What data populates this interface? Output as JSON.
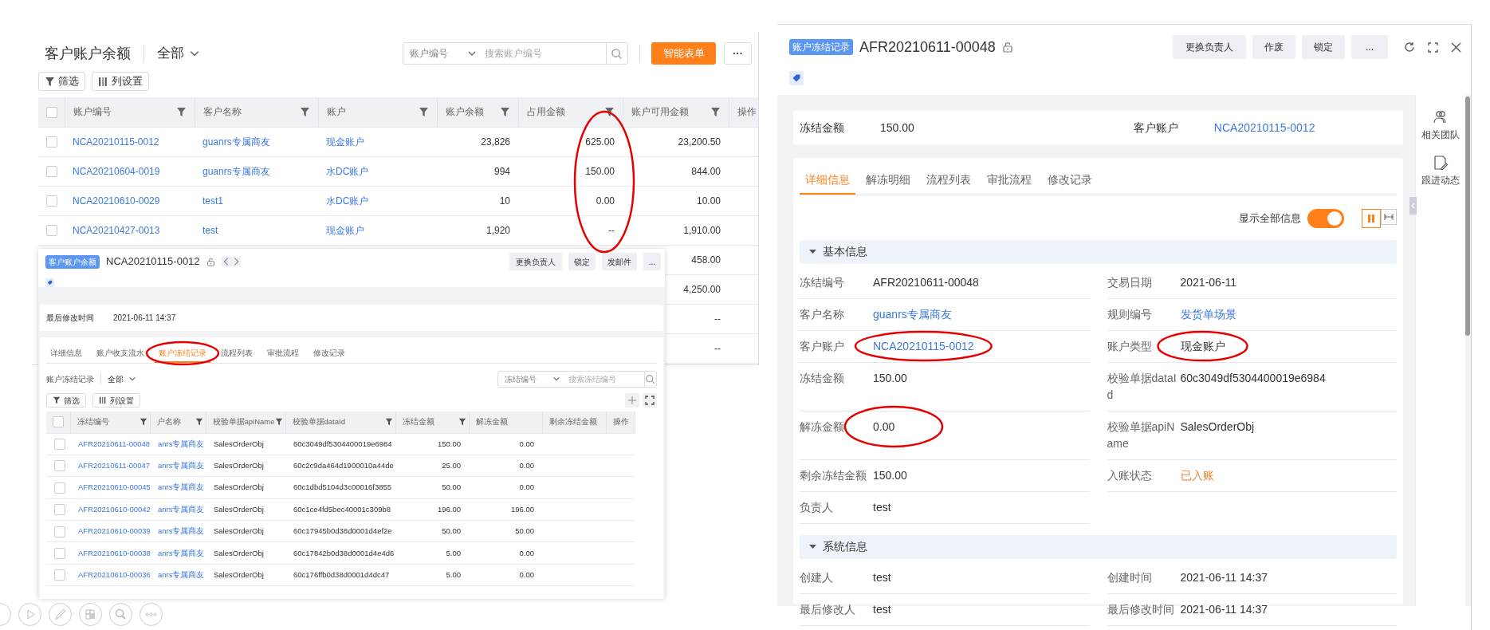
{
  "list_window": {
    "title": "客户账户余额",
    "scope": "全部",
    "search": {
      "field": "账户编号",
      "placeholder": "搜索账户编号"
    },
    "primary_button": "智能表单",
    "more_button": "···",
    "toolbar": [
      "筛选",
      "列设置"
    ],
    "table": {
      "all_checked": false,
      "columns": [
        "账户编号",
        "客户名称",
        "账户",
        "账户余额",
        "占用金额",
        "账户可用金额",
        "操作"
      ],
      "rows": [
        {
          "checked": false,
          "account_no": "NCA20210115-0012",
          "customer": "guanrs专属商友",
          "account": "现金账户",
          "balance": "23,826",
          "occupied": "625.00",
          "available": "23,200.50"
        },
        {
          "checked": false,
          "account_no": "NCA20210604-0019",
          "customer": "guanrs专属商友",
          "account": "水DC账户",
          "balance": "994",
          "occupied": "150.00",
          "available": "844.00"
        },
        {
          "checked": false,
          "account_no": "NCA20210610-0029",
          "customer": "test1",
          "account": "水DC账户",
          "balance": "10",
          "occupied": "0.00",
          "available": "10.00"
        },
        {
          "checked": false,
          "account_no": "NCA20210427-0013",
          "customer": "test",
          "account": "现金账户",
          "balance": "1,920",
          "occupied": "--",
          "available": "1,910.00"
        },
        {
          "available": "458.00"
        },
        {
          "available": "4,250.00"
        },
        {
          "available": "--"
        },
        {
          "available": "--"
        }
      ]
    }
  },
  "list_detail": {
    "badge": "客户账户余额",
    "title": "NCA20210115-0012",
    "buttons": [
      "更换负责人",
      "锁定",
      "发邮件",
      "..."
    ],
    "summary": [
      {
        "label": "最后修改时间",
        "value": "2021-06-11 14:37"
      }
    ],
    "tabs": [
      {
        "label": "详细信息",
        "selected": false
      },
      {
        "label": "账户收支流水",
        "selected": false
      },
      {
        "label": "账户冻结记录",
        "selected": true
      },
      {
        "label": "流程列表",
        "selected": false
      },
      {
        "label": "审批流程",
        "selected": false
      },
      {
        "label": "修改记录",
        "selected": false
      }
    ],
    "list": {
      "title": "账户冻结记录",
      "scope": "全部",
      "search": {
        "field": "冻结编号",
        "placeholder": "搜索冻结编号"
      },
      "toolbar": [
        "筛选",
        "列设置"
      ],
      "table": {
        "all_checked": false,
        "columns": [
          "冻结编号",
          "户名称",
          "校验单据apiName",
          "校验单据dataId",
          "冻结金额",
          "解冻金额",
          "剩余冻结金额",
          "操作"
        ],
        "rows": [
          {
            "checked": false,
            "cells": [
              "AFR20210611-00048",
              "anrs专属商友",
              "SalesOrderObj",
              "60c3049df5304400019e6984",
              "150.00",
              "0.00"
            ]
          },
          {
            "checked": false,
            "cells": [
              "AFR20210611-00047",
              "anrs专属商友",
              "SalesOrderObj",
              "60c2c9da464d1900010a44de",
              "25.00",
              "0.00"
            ]
          },
          {
            "checked": false,
            "cells": [
              "AFR20210610-00045",
              "anrs专属商友",
              "SalesOrderObj",
              "60c1dbd5104d3c00016f3855",
              "50.00",
              "0.00"
            ]
          },
          {
            "checked": false,
            "cells": [
              "AFR20210610-00042",
              "anrs专属商友",
              "SalesOrderObj",
              "60c1ce4fd5bec40001c309b8",
              "196.00",
              "196.00"
            ]
          },
          {
            "checked": false,
            "cells": [
              "AFR20210610-00039",
              "anrs专属商友",
              "SalesOrderObj",
              "60c17945b0d38d0001d4ef2e",
              "50.00",
              "50.00"
            ]
          },
          {
            "checked": false,
            "cells": [
              "AFR20210610-00038",
              "anrs专属商友",
              "SalesOrderObj",
              "60c17842b0d38d0001d4e4d6",
              "5.00",
              "0.00"
            ]
          },
          {
            "checked": false,
            "cells": [
              "AFR20210610-00036",
              "anrs专属商友",
              "SalesOrderObj",
              "60c176ffb0d38d0001d4dc47",
              "5.00",
              "0.00"
            ]
          }
        ]
      }
    }
  },
  "detail": {
    "badge": "账户冻结记录",
    "title": "AFR20210611-00048",
    "buttons": [
      "更换负责人",
      "作废",
      "锁定",
      "..."
    ],
    "summary": [
      {
        "label": "冻结金额",
        "value": "150.00",
        "kind": "text"
      },
      {
        "label": "客户账户",
        "value": "NCA20210115-0012",
        "kind": "link"
      }
    ],
    "side_actions": [
      "相关团队",
      "跟进动态"
    ],
    "tabs": [
      {
        "label": "详细信息",
        "selected": true
      },
      {
        "label": "解冻明细",
        "selected": false
      },
      {
        "label": "流程列表",
        "selected": false
      },
      {
        "label": "审批流程",
        "selected": false
      },
      {
        "label": "修改记录",
        "selected": false
      }
    ],
    "show_all": {
      "label": "显示全部信息",
      "on": true
    },
    "layout_options": [
      {
        "selected": true
      },
      {
        "selected": false
      }
    ],
    "sections": [
      {
        "title": "基本信息",
        "expanded": true,
        "fields": [
          {
            "label": "冻结编号",
            "value": "AFR20210611-00048",
            "kind": "text"
          },
          {
            "label": "交易日期",
            "value": "2021-06-11",
            "kind": "text"
          },
          {
            "label": "客户名称",
            "value": "guanrs专属商友",
            "kind": "link"
          },
          {
            "label": "规则编号",
            "value": "发货单场景",
            "kind": "link"
          },
          {
            "label": "客户账户",
            "value": "NCA20210115-0012",
            "kind": "link"
          },
          {
            "label": "账户类型",
            "value": "现金账户",
            "kind": "text"
          },
          {
            "label": "冻结金额",
            "value": "150.00",
            "kind": "text"
          },
          {
            "label": "校验单据dataId",
            "value": "60c3049df5304400019e6984",
            "kind": "text"
          },
          {
            "label": "解冻金额",
            "value": "0.00",
            "kind": "text"
          },
          {
            "label": "校验单据apiName",
            "value": "SalesOrderObj",
            "kind": "text"
          },
          {
            "label": "剩余冻结金额",
            "value": "150.00",
            "kind": "text"
          },
          {
            "label": "入账状态",
            "value": "已入账",
            "kind": "status"
          },
          {
            "label": "负责人",
            "value": "test",
            "kind": "text"
          }
        ]
      },
      {
        "title": "系统信息",
        "expanded": true,
        "fields": [
          {
            "label": "创建人",
            "value": "test",
            "kind": "text"
          },
          {
            "label": "创建时间",
            "value": "2021-06-11 14:37",
            "kind": "text"
          },
          {
            "label": "最后修改人",
            "value": "test",
            "kind": "text"
          },
          {
            "label": "最后修改时间",
            "value": "2021-06-11 14:37",
            "kind": "text"
          }
        ]
      }
    ]
  },
  "annotations": [
    {
      "kind": "ellipse",
      "color": "#e60000"
    },
    {
      "kind": "ellipse",
      "color": "#e60000"
    },
    {
      "kind": "ellipse",
      "color": "#e60000"
    },
    {
      "kind": "ellipse",
      "color": "#e60000"
    },
    {
      "kind": "ellipse",
      "color": "#e60000"
    }
  ]
}
